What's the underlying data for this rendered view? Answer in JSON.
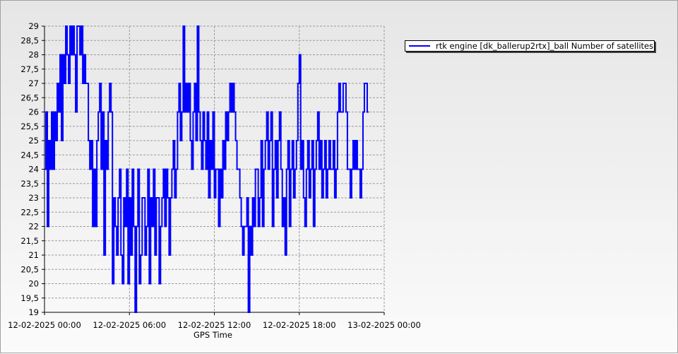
{
  "chart_data": {
    "type": "line",
    "title": "",
    "xlabel": "GPS Time",
    "ylabel": "",
    "ylim": [
      19,
      29
    ],
    "yticks": [
      "29",
      "28,5",
      "28",
      "27,5",
      "27",
      "26,5",
      "26",
      "25,5",
      "25",
      "24,5",
      "24",
      "23,5",
      "23",
      "22,5",
      "22",
      "21,5",
      "21",
      "20,5",
      "20",
      "19,5",
      "19"
    ],
    "xlim": [
      "2025-02-12T00:00",
      "2025-02-13T00:00"
    ],
    "xticks": [
      {
        "at": 0,
        "label": "12-02-2025 00:00"
      },
      {
        "at": 6,
        "label": "12-02-2025 06:00"
      },
      {
        "at": 12,
        "label": "12-02-2025 12:00"
      },
      {
        "at": 18,
        "label": "12-02-2025 18:00"
      },
      {
        "at": 24,
        "label": "13-02-2025 00:00"
      }
    ],
    "grid": true,
    "legend_position": "top-right, outside plot",
    "series": [
      {
        "name": "rtk engine [dk_ballerup2rtx]_ball Number of satellites",
        "color": "#0000ff",
        "x_hours": [
          0,
          0.1,
          0.2,
          0.3,
          0.4,
          0.5,
          0.6,
          0.7,
          0.8,
          0.9,
          1.0,
          1.1,
          1.2,
          1.3,
          1.4,
          1.5,
          1.6,
          1.7,
          1.8,
          1.9,
          2.0,
          2.1,
          2.2,
          2.3,
          2.4,
          2.5,
          2.6,
          2.7,
          2.8,
          2.9,
          3.0,
          3.1,
          3.2,
          3.3,
          3.4,
          3.5,
          3.6,
          3.7,
          3.8,
          3.9,
          4.0,
          4.1,
          4.2,
          4.3,
          4.4,
          4.5,
          4.6,
          4.7,
          4.8,
          4.9,
          5.0,
          5.1,
          5.2,
          5.3,
          5.4,
          5.5,
          5.6,
          5.7,
          5.8,
          5.9,
          6.0,
          6.1,
          6.2,
          6.3,
          6.4,
          6.5,
          6.6,
          6.7,
          6.8,
          6.9,
          7.0,
          7.1,
          7.2,
          7.3,
          7.4,
          7.5,
          7.6,
          7.7,
          7.8,
          7.9,
          8.0,
          8.1,
          8.2,
          8.3,
          8.4,
          8.5,
          8.6,
          8.7,
          8.8,
          8.9,
          9.0,
          9.1,
          9.2,
          9.3,
          9.4,
          9.5,
          9.6,
          9.7,
          9.8,
          9.9,
          10.0,
          10.1,
          10.2,
          10.3,
          10.4,
          10.5,
          10.6,
          10.7,
          10.8,
          10.9,
          11.0,
          11.1,
          11.2,
          11.3,
          11.4,
          11.5,
          11.6,
          11.7,
          11.8,
          11.9,
          12.0,
          12.1,
          12.2,
          12.3,
          12.4,
          12.5,
          12.6,
          12.7,
          12.8,
          12.9,
          13.0,
          13.1,
          13.2,
          13.3,
          13.4,
          13.5,
          13.6,
          13.7,
          13.8,
          13.9,
          14.0,
          14.1,
          14.2,
          14.3,
          14.4,
          14.5,
          14.6,
          14.7,
          14.8,
          14.9,
          15.0,
          15.1,
          15.2,
          15.3,
          15.4,
          15.5,
          15.6,
          15.7,
          15.8,
          15.9,
          16.0,
          16.1,
          16.2,
          16.3,
          16.4,
          16.5,
          16.6,
          16.7,
          16.8,
          16.9,
          17.0,
          17.1,
          17.2,
          17.3,
          17.4,
          17.5,
          17.6,
          17.7,
          17.8,
          17.9,
          18.0,
          18.1,
          18.2,
          18.3,
          18.4,
          18.5,
          18.6,
          18.7,
          18.8,
          18.9,
          19.0,
          19.1,
          19.2,
          19.3,
          19.4,
          19.5,
          19.6,
          19.7,
          19.8,
          19.9,
          20.0,
          20.1,
          20.2,
          20.3,
          20.4,
          20.5,
          20.6,
          20.7,
          20.8,
          20.9,
          21.0,
          21.1,
          21.2,
          21.3,
          21.4,
          21.5,
          21.6,
          21.7,
          21.8,
          21.9,
          22.0,
          22.1,
          22.2,
          22.3,
          22.4,
          22.5,
          22.6,
          22.7,
          22.8,
          22.9,
          23.0,
          23.1,
          23.2,
          23.3,
          23.4,
          23.5,
          23.6,
          23.7,
          23.8,
          23.9,
          24.0
        ],
        "values": [
          24,
          26,
          22,
          25,
          24,
          26,
          24,
          26,
          25,
          27,
          26,
          28,
          25,
          28,
          27,
          29,
          28,
          27,
          29,
          28,
          29,
          28,
          26,
          29,
          29,
          28,
          29,
          27,
          28,
          27,
          27,
          25,
          24,
          25,
          22,
          24,
          22,
          25,
          26,
          27,
          24,
          26,
          21,
          25,
          24,
          26,
          27,
          26,
          20,
          23,
          22,
          21,
          23,
          24,
          21,
          20,
          23,
          22,
          24,
          20,
          23,
          21,
          24,
          22,
          19,
          22,
          24,
          20,
          21,
          23,
          23,
          21,
          22,
          24,
          20,
          23,
          22,
          24,
          21,
          23,
          23,
          20,
          22,
          23,
          24,
          22,
          24,
          23,
          21,
          23,
          24,
          25,
          23,
          24,
          26,
          27,
          25,
          26,
          29,
          26,
          27,
          26,
          27,
          25,
          24,
          26,
          27,
          25,
          29,
          26,
          25,
          24,
          26,
          25,
          24,
          26,
          23,
          25,
          24,
          26,
          23,
          24,
          24,
          22,
          24,
          23,
          25,
          24,
          26,
          25,
          26,
          27,
          26,
          27,
          26,
          25,
          24,
          24,
          23,
          22,
          21,
          22,
          22,
          23,
          19,
          22,
          21,
          23,
          22,
          24,
          24,
          22,
          23,
          25,
          22,
          24,
          25,
          26,
          24,
          25,
          26,
          22,
          24,
          25,
          23,
          25,
          26,
          24,
          22,
          23,
          21,
          24,
          25,
          22,
          24,
          25,
          23,
          24,
          25,
          27,
          28,
          24,
          25,
          23,
          22,
          24,
          25,
          23,
          24,
          25,
          22,
          24,
          25,
          26,
          24,
          25,
          23,
          24,
          25,
          23,
          24,
          25,
          24,
          24,
          25,
          23,
          24,
          26,
          27,
          26,
          26,
          27,
          27,
          26,
          24,
          24,
          23,
          24,
          25,
          24,
          25,
          24,
          24,
          23,
          24,
          26,
          27,
          27,
          26,
          26
        ]
      }
    ]
  }
}
